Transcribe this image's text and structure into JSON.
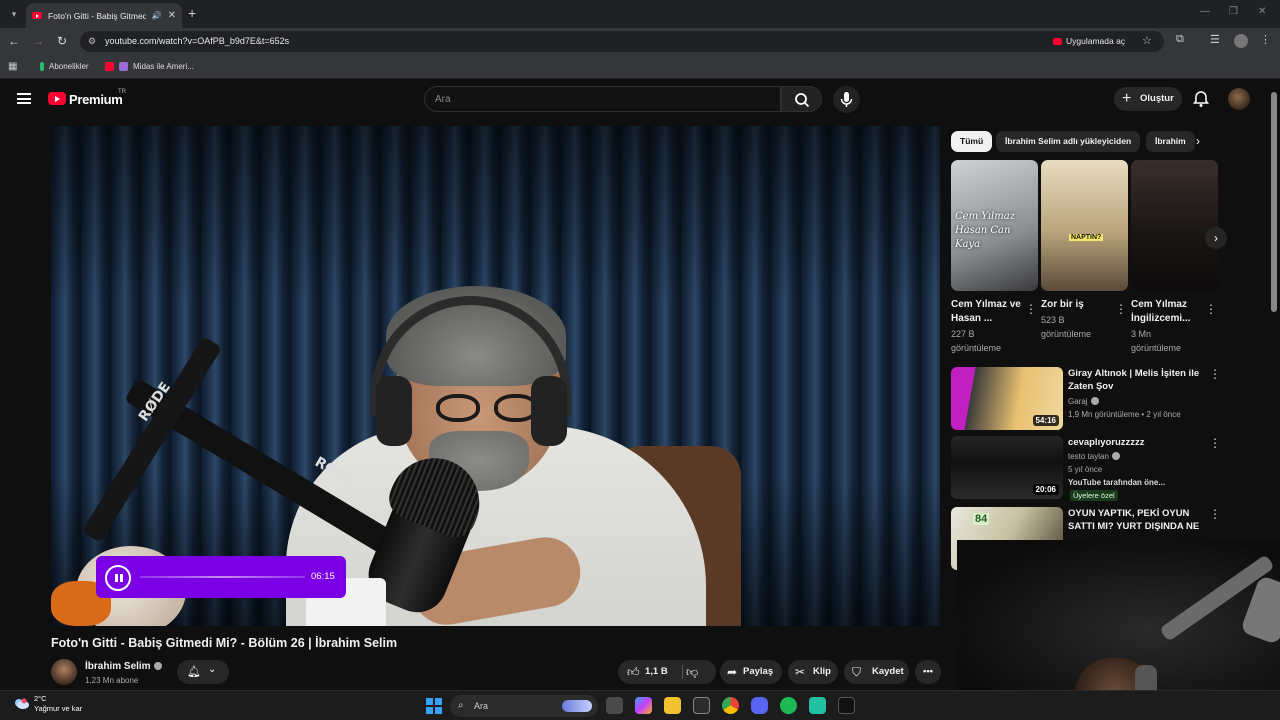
{
  "browser": {
    "tab_title": "Foto'n Gitti - Babiş Gitmedi",
    "url": "youtube.com/watch?v=OAfPB_b9d7E&t=652s",
    "open_in_app": "Uygulamada aç",
    "bookmarks": [
      {
        "label": "Abonelikler",
        "color": "#2bb673"
      },
      {
        "label": "Midas ile Ameri...",
        "color": "#9c6ad6"
      }
    ]
  },
  "masthead": {
    "brand": "Premium",
    "country": "TR",
    "search_placeholder": "Ara",
    "create_label": "Oluştur"
  },
  "player": {
    "widget_time": "06:15",
    "accent": "#7b00e6"
  },
  "video": {
    "title": "Foto'n Gitti - Babiş Gitmedi Mi? - Bölüm 26 | İbrahim Selim",
    "channel": "İbrahim Selim",
    "subscribers": "1,23 Mn abone",
    "likes": "1,1 B",
    "share": "Paylaş",
    "clip": "Klip",
    "save": "Kaydet"
  },
  "chips": [
    "Tümü",
    "İbrahim Selim adlı yükleyiciden",
    "İbrahim"
  ],
  "shorts": [
    {
      "title": "Cem Yılmaz ve Hasan ...",
      "views": "227 B görüntüleme",
      "thumb_text": "Cem Yılmaz Hasan Can Kaya"
    },
    {
      "title": "Zor bir iş",
      "views": "523 B görüntüleme",
      "thumb_text": "NAPTIN?"
    },
    {
      "title": "Cem Yılmaz İngilizcemi...",
      "views": "3 Mn görüntüleme",
      "thumb_text": ""
    }
  ],
  "recommendations": [
    {
      "title": "Giray Altınok | Melis İşiten ile Zaten Şov",
      "channel": "Garaj",
      "meta": "1,9 Mn görüntüleme • 2 yıl önce",
      "duration": "54:16"
    },
    {
      "title": "cevaplıyoruzzzzz",
      "channel": "testo taylan",
      "meta": "5 yıl önce",
      "extra": "YouTube tarafından öne...",
      "badge": "Üyelere özel",
      "duration": "20:06"
    },
    {
      "title": "OYUN YAPTIK, PEKİ OYUN SATTI MI? YURT DIŞINDA NE ...",
      "channel": "",
      "meta": "",
      "duration": "",
      "thumb_text": "84"
    }
  ],
  "taskbar": {
    "temperature": "2°C",
    "weather": "Yağmur ve kar",
    "search": "Ara"
  }
}
